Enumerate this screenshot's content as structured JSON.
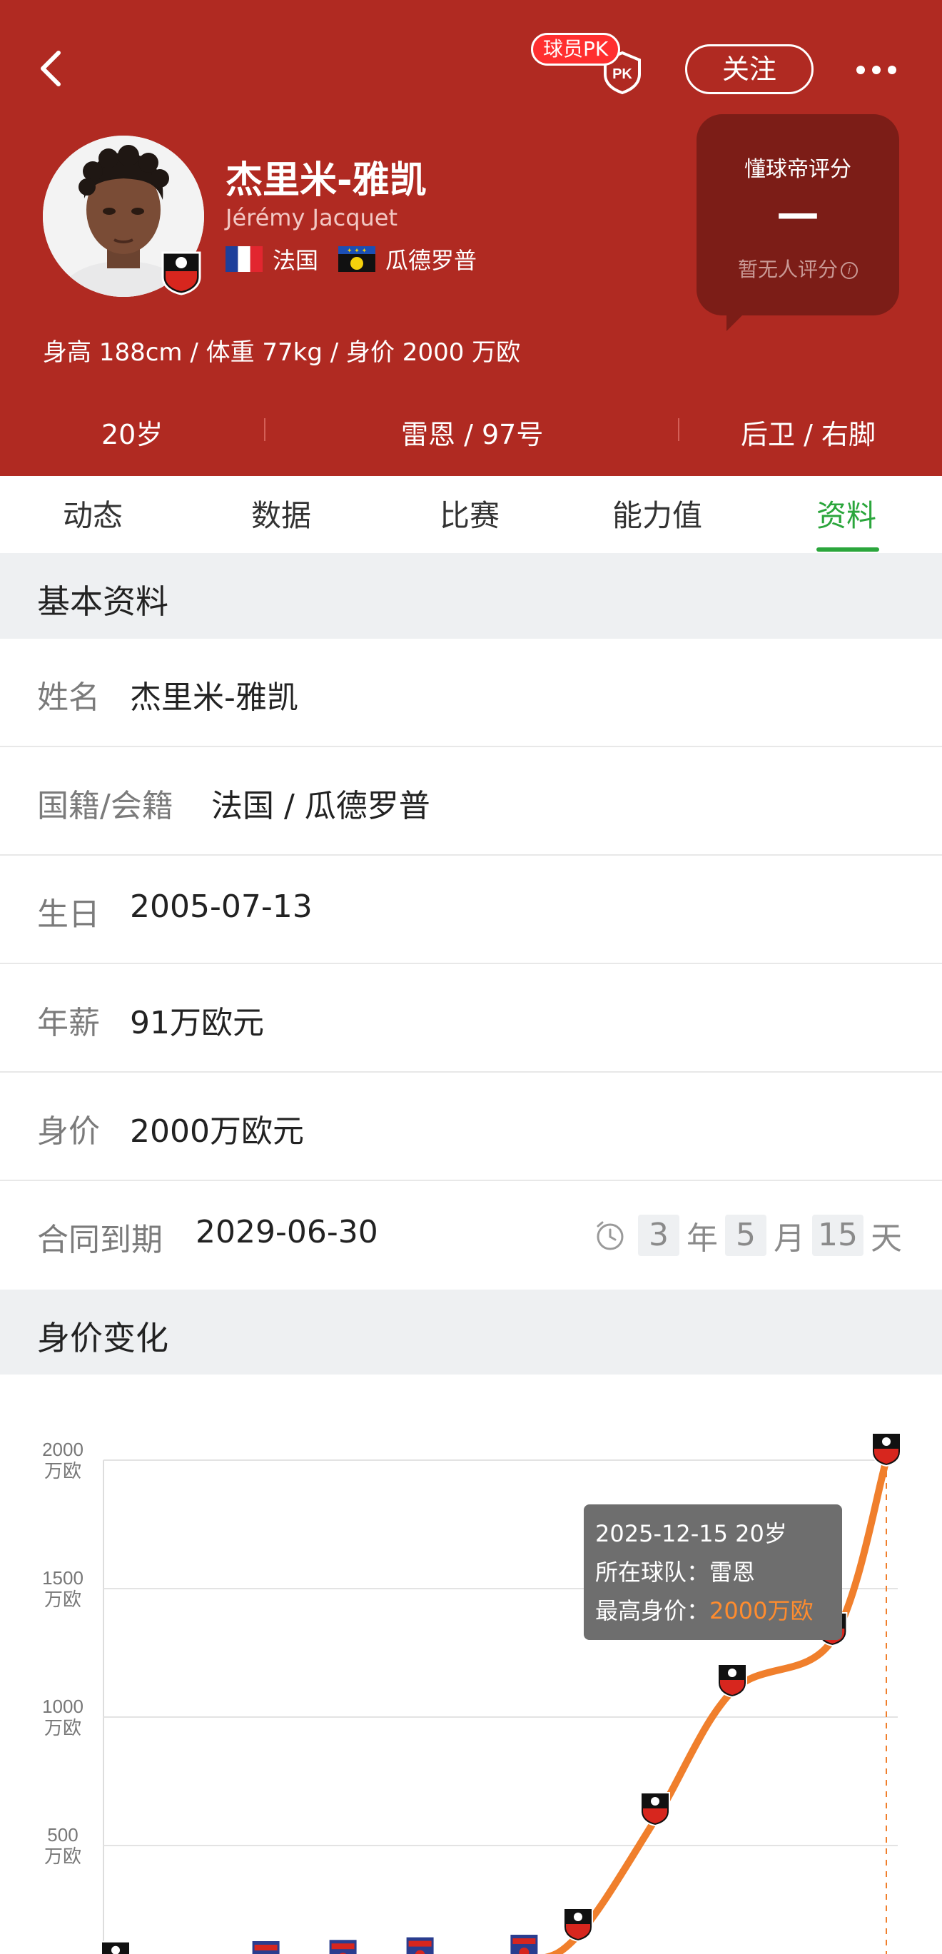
{
  "header": {
    "pk_label": "球员PK",
    "pk_shield_text": "PK",
    "follow_label": "关注",
    "player_name_cn": "杰里米-雅凯",
    "player_name_en": "Jérémy Jacquet",
    "nationality_1": "法国",
    "nationality_2": "瓜德罗普",
    "rating": {
      "title": "懂球帝评分",
      "value": "—",
      "note": "暂无人评分"
    },
    "body_info": "身高 188cm / 体重 77kg / 身价 2000 万欧",
    "stats": {
      "age": "20岁",
      "club_number": "雷恩 / 97号",
      "position_foot": "后卫 / 右脚"
    }
  },
  "tabs": [
    {
      "label": "动态"
    },
    {
      "label": "数据"
    },
    {
      "label": "比赛"
    },
    {
      "label": "能力值"
    },
    {
      "label": "资料"
    }
  ],
  "active_tab": "资料",
  "basic_info": {
    "section_title": "基本资料",
    "rows": [
      {
        "label": "姓名",
        "value": "杰里米-雅凯"
      },
      {
        "label": "国籍/会籍",
        "value": "法国 / 瓜德罗普"
      },
      {
        "label": "生日",
        "value": "2005-07-13"
      },
      {
        "label": "年薪",
        "value": "91万欧元"
      },
      {
        "label": "身价",
        "value": "2000万欧元"
      },
      {
        "label": "合同到期",
        "value": "2029-06-30"
      }
    ],
    "contract_countdown": {
      "years": "3",
      "years_unit": "年",
      "months": "5",
      "months_unit": "月",
      "days": "15",
      "days_unit": "天"
    }
  },
  "value_section": {
    "section_title": "身价变化"
  },
  "tooltip": {
    "line1": "2025-12-15 20岁",
    "team_label": "所在球队：",
    "team_value": "雷恩",
    "max_label": "最高身价：",
    "max_value": "2000万欧"
  },
  "colors": {
    "header_bg": "#b02a22",
    "accent_green": "#2ba63c",
    "line_orange": "#f07f2c",
    "rennes_red": "#d7261e",
    "clermont_blue": "#2a3d8f"
  },
  "chart_data": {
    "type": "line",
    "ylabel": "",
    "ylim": [
      0,
      2000
    ],
    "y_ticks": [
      {
        "value": 2000,
        "line1": "2000",
        "line2": "万欧"
      },
      {
        "value": 1500,
        "line1": "1500",
        "line2": "万欧"
      },
      {
        "value": 1000,
        "line1": "1000",
        "line2": "万欧"
      },
      {
        "value": 500,
        "line1": "500",
        "line2": "万欧"
      }
    ],
    "points": [
      {
        "x": 0.0,
        "y": 20,
        "club": "雷恩"
      },
      {
        "x": 1.95,
        "y": 25,
        "club": "克莱蒙"
      },
      {
        "x": 2.95,
        "y": 30,
        "club": "克莱蒙"
      },
      {
        "x": 3.95,
        "y": 40,
        "club": "克莱蒙"
      },
      {
        "x": 5.3,
        "y": 50,
        "club": "克莱蒙"
      },
      {
        "x": 6.0,
        "y": 150,
        "club": "雷恩"
      },
      {
        "x": 7.0,
        "y": 600,
        "club": "雷恩"
      },
      {
        "x": 8.0,
        "y": 1100,
        "club": "雷恩"
      },
      {
        "x": 9.3,
        "y": 1300,
        "club": "雷恩"
      },
      {
        "x": 10.0,
        "y": 2000,
        "club": "雷恩"
      }
    ],
    "highlight_index": 9,
    "grid": true
  }
}
